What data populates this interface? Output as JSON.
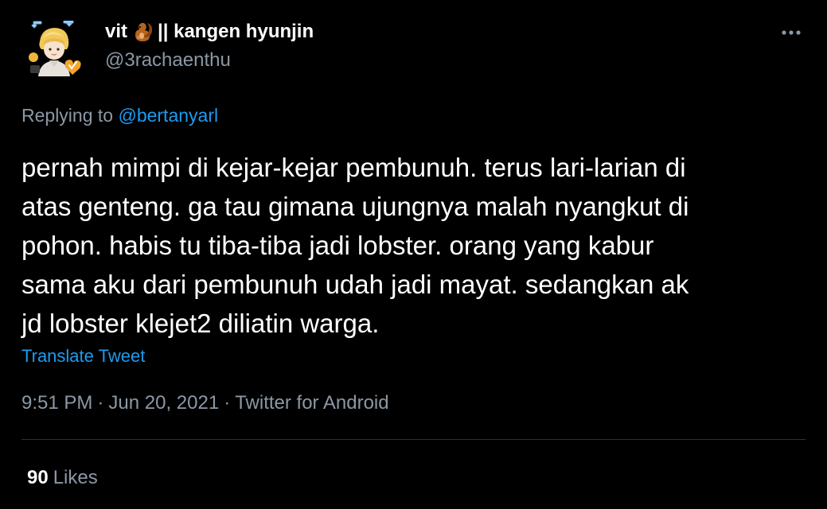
{
  "author": {
    "display_name_start": "vit",
    "display_name_emoji": "squirrel-emoji",
    "display_name_end": "|| kangen hyunjin",
    "handle": "@3rachaenthu"
  },
  "reply": {
    "prefix": "Replying to",
    "mention": "@bertanyarl"
  },
  "tweet": {
    "lines": [
      "pernah mimpi di kejar-kejar pembunuh. terus lari-larian di",
      "atas genteng. ga tau gimana ujungnya malah nyangkut di",
      "pohon. habis tu tiba-tiba jadi lobster. orang yang kabur",
      "sama aku dari pembunuh udah jadi mayat. sedangkan ak",
      "jd lobster klejet2 diliatin warga."
    ],
    "translate_label": "Translate Tweet",
    "time": "9:51 PM",
    "date": "Jun 20, 2021",
    "source": "Twitter for Android",
    "separator": "·"
  },
  "stats": {
    "likes_count": "90",
    "likes_label": "Likes"
  },
  "icons": {
    "more": "more-horizontal-icon",
    "avatar": "avatar"
  },
  "colors": {
    "background": "#000000",
    "text_primary": "#ffffff",
    "text_secondary": "#8b98a5",
    "link": "#1d9bf0",
    "divider": "#2f3336"
  }
}
